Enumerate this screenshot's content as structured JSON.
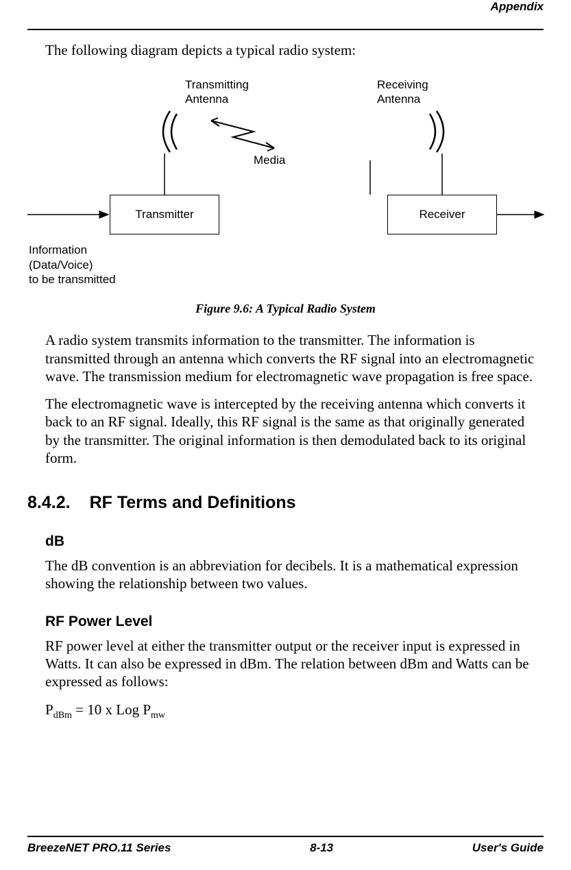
{
  "header": {
    "section": "Appendix"
  },
  "intro": "The following diagram depicts a typical radio system:",
  "diagram": {
    "tx_antenna": "Transmitting\nAntenna",
    "rx_antenna": "Receiving\nAntenna",
    "media": "Media",
    "transmitter": "Transmitter",
    "receiver": "Receiver",
    "info": "Information\n(Data/Voice)\nto be transmitted"
  },
  "caption": "Figure 9.6: A Typical Radio System",
  "para1": "A radio system transmits information to the transmitter. The information is transmitted through an antenna which converts the RF signal into an electromagnetic wave. The transmission medium for electromagnetic wave propagation is free space.",
  "para2": "The electromagnetic wave is intercepted by the receiving antenna which converts it back to an RF signal. Ideally, this RF signal is the same as that originally generated by the transmitter. The original information is then demodulated back to its original form.",
  "section": {
    "num": "8.4.2.",
    "title": "RF Terms and Definitions"
  },
  "db": {
    "head": "dB",
    "body": "The dB convention is an abbreviation for decibels. It is a mathematical expression showing the relationship between two values."
  },
  "rf": {
    "head": "RF Power Level",
    "body": "RF power level at either the transmitter output or the receiver input is expressed in Watts. It can also be expressed in dBm. The relation between dBm and Watts can be expressed as follows:",
    "formula_pre": "P",
    "formula_sub1": "dBm",
    "formula_mid": " = 10 x Log P",
    "formula_sub2": "mw"
  },
  "footer": {
    "left": "BreezeNET PRO.11 Series",
    "center": "8-13",
    "right": "User's Guide"
  }
}
